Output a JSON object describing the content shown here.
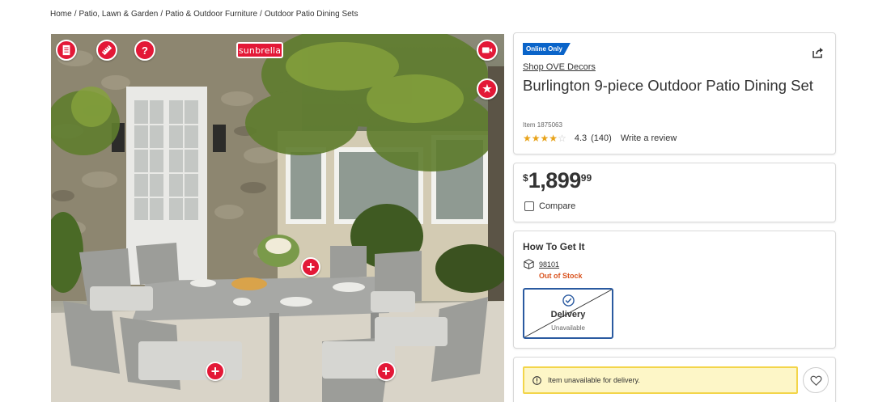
{
  "breadcrumb": {
    "items": [
      "Home",
      "Patio, Lawn & Garden",
      "Patio & Outdoor Furniture",
      "Outdoor Patio Dining Sets"
    ],
    "separator": "/"
  },
  "gallery": {
    "brand_tag": "sunbrella",
    "icons": [
      "document-icon",
      "ruler-icon",
      "help-icon",
      "video-icon",
      "star-badge-icon",
      "plus-icon"
    ]
  },
  "product": {
    "badge": "Online Only",
    "brand": "Shop OVE Decors",
    "title": "Burlington 9-piece Outdoor Patio Dining Set",
    "item_number": "Item 1875063",
    "rating": "4.3",
    "rating_value": 4.3,
    "review_count": "(140)",
    "write_review": "Write a review"
  },
  "price": {
    "currency": "$",
    "main": "1,899",
    "cents": "99",
    "compare_label": "Compare"
  },
  "fulfillment": {
    "title": "How To Get It",
    "zip": "98101",
    "stock_status": "Out of Stock",
    "delivery_label": "Delivery",
    "delivery_status": "Unavailable"
  },
  "alert": {
    "message": "Item unavailable for delivery."
  },
  "colors": {
    "accent_red": "#e31837",
    "badge_blue": "#0a64c9",
    "out_of_stock": "#d9531e",
    "alert_bg": "#fdf6c7",
    "alert_border": "#f3d54a",
    "star": "#e8a31a"
  }
}
